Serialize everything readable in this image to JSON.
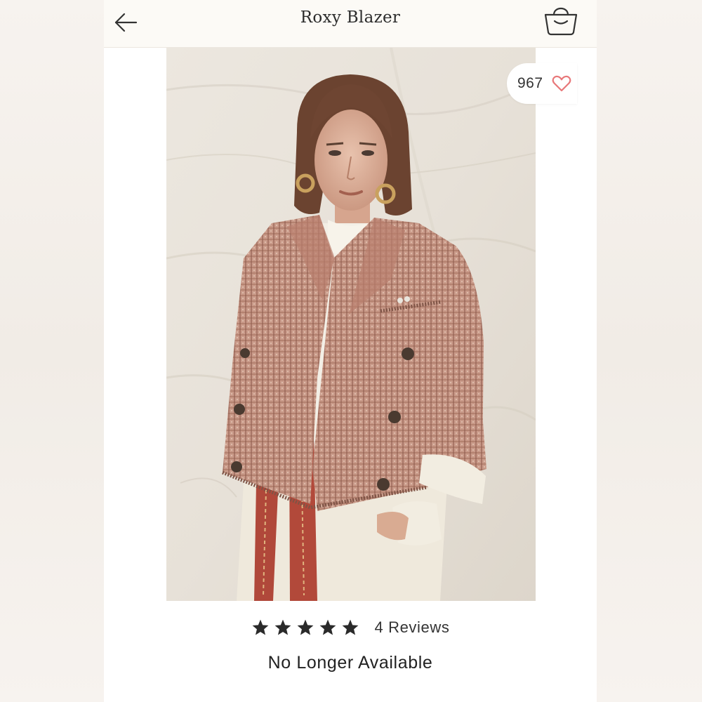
{
  "header": {
    "title": "Roxy Blazer",
    "back_icon": "back-arrow-icon",
    "bag_icon": "shopping-bag-icon"
  },
  "product": {
    "image_description_icon": "product-photo",
    "likes": "967",
    "heart_icon": "heart-outline-icon",
    "rating": 5,
    "rating_max": 5,
    "reviews_label": "4 Reviews",
    "availability": "No Longer Available"
  },
  "colors": {
    "heart": "#e8787a",
    "text": "#2c2c2c",
    "header_bg": "#fcfaf6",
    "star": "#2a2a2a"
  }
}
